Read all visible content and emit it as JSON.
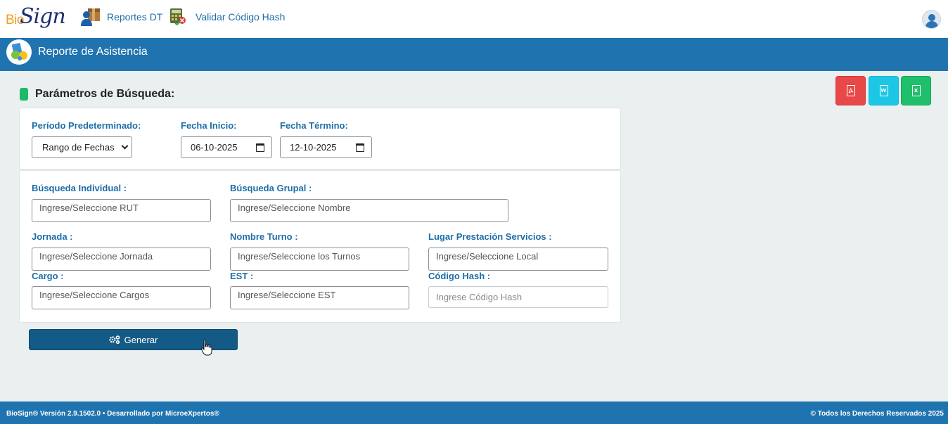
{
  "brand": {
    "logo_bio": "Bio",
    "logo_sign": "Sign"
  },
  "nav": {
    "items": [
      {
        "label": "Reportes DT",
        "icon": "user-box-icon"
      },
      {
        "label": "Validar Código Hash",
        "icon": "calculator-icon"
      }
    ]
  },
  "header": {
    "title": "Reporte de Asistencia"
  },
  "section": {
    "title": "Parámetros de Búsqueda:"
  },
  "exports": [
    {
      "label": "PDF",
      "color": "#e84848"
    },
    {
      "label": "W",
      "color": "#1cc7e6"
    },
    {
      "label": "X",
      "color": "#1fbf6c"
    }
  ],
  "period": {
    "label": "Período Predeterminado:",
    "selected": "Rango de Fechas",
    "start_label": "Fecha Inicio:",
    "start_value": "06-10-2025",
    "end_label": "Fecha Término:",
    "end_value": "12-10-2025"
  },
  "filters": {
    "individual": {
      "label": "Búsqueda Individual :",
      "placeholder": "Ingrese/Seleccione RUT"
    },
    "grupal": {
      "label": "Búsqueda Grupal :",
      "placeholder": "Ingrese/Seleccione Nombre"
    },
    "jornada": {
      "label": "Jornada :",
      "placeholder": "Ingrese/Seleccione Jornada"
    },
    "turno": {
      "label": "Nombre Turno :",
      "placeholder": "Ingrese/Seleccione los Turnos"
    },
    "lugar": {
      "label": "Lugar Prestación Servicios :",
      "placeholder": "Ingrese/Seleccione Local"
    },
    "cargo": {
      "label": "Cargo :",
      "placeholder": "Ingrese/Seleccione Cargos"
    },
    "est": {
      "label": "EST :",
      "placeholder": "Ingrese/Seleccione EST"
    },
    "hash": {
      "label": "Código Hash :",
      "placeholder": "Ingrese Código Hash"
    }
  },
  "actions": {
    "generate_label": "Generar"
  },
  "footer": {
    "left": "BioSign® Versión 2.9.1502.0 • Desarrollado por MicroeXpertos®",
    "right": "© Todos los Derechos Reservados 2025"
  },
  "colors": {
    "primary": "#1f73ae",
    "button": "#145a86",
    "accent_green": "#1fb86a",
    "label_blue": "#1d6ea8"
  }
}
